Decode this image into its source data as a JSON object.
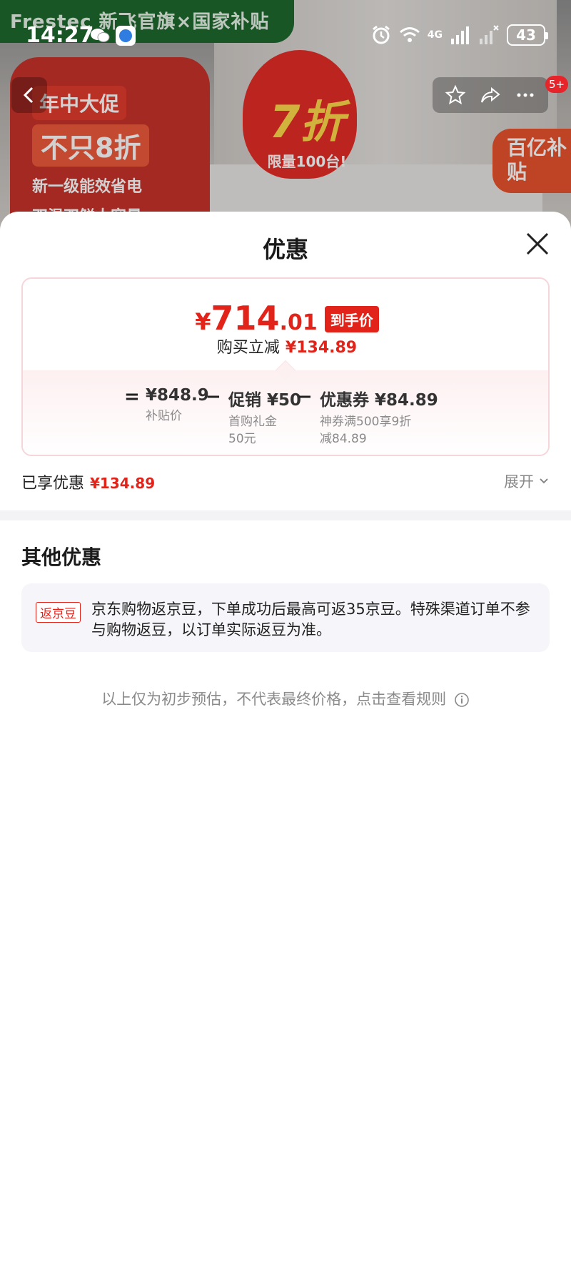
{
  "status_bar": {
    "time": "14:27",
    "network": "4G",
    "battery": "43"
  },
  "banner": {
    "brand": "Frestec 新飞官旗×国家补贴",
    "promo_line1": "年中大促",
    "promo_line2": "不只8折",
    "promo_line3": "新一级能效省电",
    "promo_line4": "双温双鲜大容量",
    "flame_big": "7折",
    "flame_sub": "限量100台!",
    "subsidy": "百亿补贴",
    "message_badge": "5+"
  },
  "sheet": {
    "title": "优惠",
    "final_price": {
      "currency": "¥",
      "integer": "714",
      "decimal": ".01",
      "tag": "到手价"
    },
    "reduce": {
      "label": "购买立减",
      "amount": "¥134.89"
    },
    "formula": {
      "equals": "=",
      "minus": "−",
      "items": [
        {
          "value": "¥848.9",
          "desc": "补贴价"
        },
        {
          "value": "促销 ¥50",
          "desc": "首购礼金\n50元"
        },
        {
          "value": "优惠券 ¥84.89",
          "desc": "神券满500享9折\n减84.89"
        }
      ]
    },
    "enjoyed": {
      "label": "已享优惠",
      "amount": "¥134.89",
      "expand_label": "展开"
    },
    "other": {
      "title": "其他优惠",
      "bean_tag": "返京豆",
      "bean_text": "京东购物返京豆，下单成功后最高可返35京豆。特殊渠道订单不参与购物返豆，以订单实际返豆为准。"
    },
    "disclaimer": "以上仅为初步预估，不代表最终价格，点击查看规则"
  },
  "colors": {
    "accent_red": "#e2231a",
    "card_border": "#f6d6da",
    "muted_text": "#8a8a8a"
  }
}
